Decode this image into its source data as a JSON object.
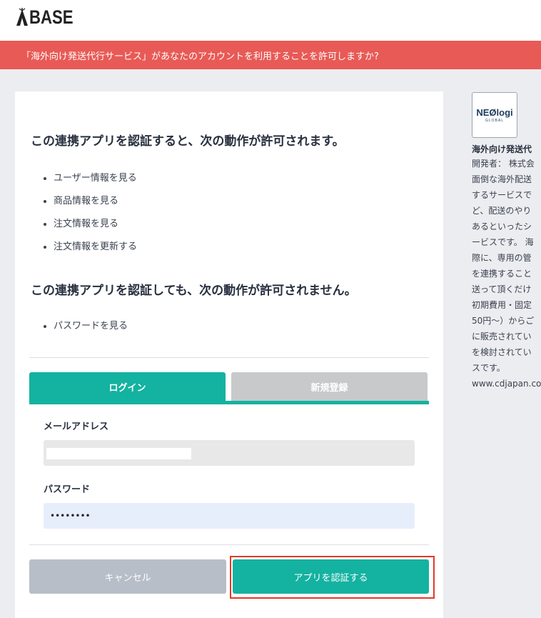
{
  "brand": {
    "name": "BASE"
  },
  "banner": {
    "text": "「海外向け発送代行サービス」があなたのアカウントを利用することを許可しますか?"
  },
  "permissions": {
    "allowed_title": "この連携アプリを認証すると、次の動作が許可されます。",
    "allowed": [
      "ユーザー情報を見る",
      "商品情報を見る",
      "注文情報を見る",
      "注文情報を更新する"
    ],
    "denied_title": "この連携アプリを認証しても、次の動作が許可されません。",
    "denied": [
      "パスワードを見る"
    ]
  },
  "tabs": {
    "login": "ログイン",
    "register": "新規登録"
  },
  "form": {
    "email_label": "メールアドレス",
    "email_value": "",
    "password_label": "パスワード",
    "password_value": "••••••••"
  },
  "buttons": {
    "cancel": "キャンセル",
    "authorize": "アプリを認証する"
  },
  "app": {
    "logo_text": "NEØlogi",
    "logo_sub": "GLOBAL",
    "name": "海外向け発送代",
    "description_lines": [
      "開発者： 株式会",
      "面倒な海外配送",
      "するサービスで",
      "ど、配送のやり",
      "あるといったシ",
      "ービスです。 海",
      "際に、専用の管",
      "を連携すること",
      "送って頂くだけ",
      "初期費用・固定",
      "50円〜）からご",
      "に販売されてい",
      "を検討されてい",
      "スです。",
      "www.cdjapan.co"
    ]
  },
  "colors": {
    "accent": "#14b2a0",
    "banner": "#e85a56",
    "cancel": "#b8bec8",
    "highlight": "#e23a28"
  }
}
